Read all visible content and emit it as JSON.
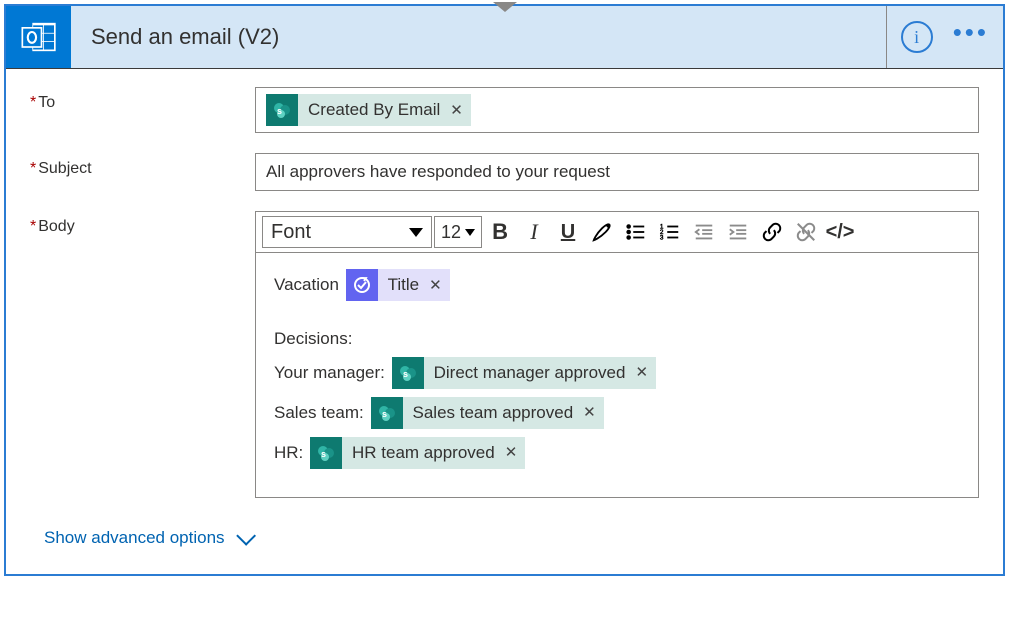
{
  "header": {
    "title": "Send an email (V2)"
  },
  "fields": {
    "to_label": "To",
    "subject_label": "Subject",
    "body_label": "Body",
    "subject_value": "All approvers have responded to your request"
  },
  "tokens": {
    "created_by": "Created By Email",
    "title": "Title",
    "manager_approved": "Direct manager approved",
    "sales_approved": "Sales team approved",
    "hr_approved": "HR team approved"
  },
  "body_text": {
    "vacation": "Vacation",
    "decisions": "Decisions:",
    "your_manager": "Your manager:",
    "sales_team": "Sales team:",
    "hr": "HR:"
  },
  "toolbar": {
    "font": "Font",
    "size": "12"
  },
  "footer": {
    "advanced": "Show advanced options"
  }
}
